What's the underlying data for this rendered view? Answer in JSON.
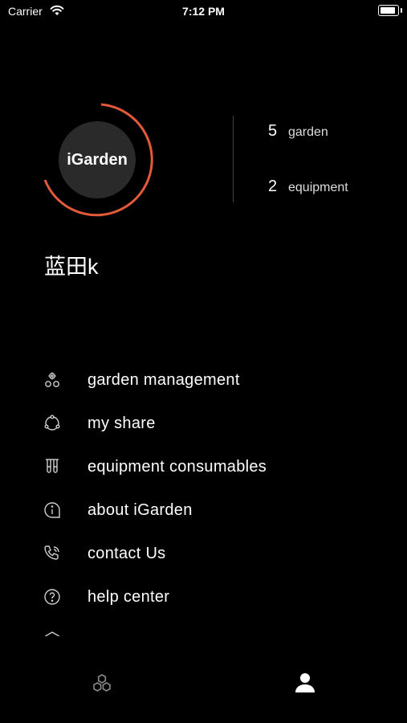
{
  "status": {
    "carrier": "Carrier",
    "time": "7:12 PM",
    "battery_level": 1.0
  },
  "profile": {
    "logo_text": "iGarden",
    "ring_color": "#e25a3a",
    "username": "蓝田k",
    "stats": [
      {
        "count": "5",
        "label": "garden"
      },
      {
        "count": "2",
        "label": "equipment"
      }
    ]
  },
  "menu": {
    "items": [
      {
        "label": "garden management",
        "icon": "garden-management-icon"
      },
      {
        "label": "my share",
        "icon": "share-icon"
      },
      {
        "label": "equipment consumables",
        "icon": "test-tubes-icon"
      },
      {
        "label": "about iGarden",
        "icon": "info-icon"
      },
      {
        "label": "contact Us",
        "icon": "phone-icon"
      },
      {
        "label": "help center",
        "icon": "help-icon"
      },
      {
        "label": "...",
        "icon": "settings-icon"
      }
    ]
  },
  "tabbar": {
    "tabs": [
      {
        "name": "home",
        "icon": "hexagons-icon",
        "active": false
      },
      {
        "name": "profile",
        "icon": "person-icon",
        "active": true
      }
    ]
  }
}
